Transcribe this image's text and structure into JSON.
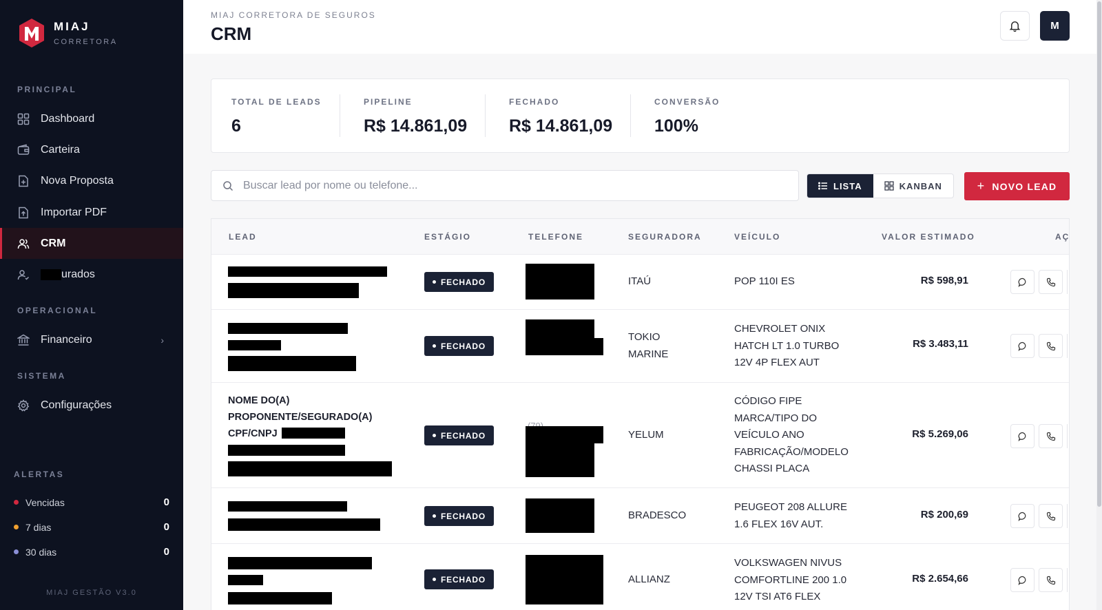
{
  "brand": {
    "name": "MIAJ",
    "sub": "CORRETORA"
  },
  "sidebar": {
    "sections": {
      "principal": "PRINCIPAL",
      "operacional": "OPERACIONAL",
      "sistema": "SISTEMA",
      "alertas": "ALERTAS"
    },
    "items": [
      {
        "label": "Dashboard",
        "icon": "grid-icon"
      },
      {
        "label": "Carteira",
        "icon": "wallet-icon"
      },
      {
        "label": "Nova Proposta",
        "icon": "file-plus-icon"
      },
      {
        "label": "Importar PDF",
        "icon": "file-upload-icon"
      },
      {
        "label": "CRM",
        "icon": "users-icon",
        "active": true
      },
      {
        "label": "urados",
        "icon": "user-check-icon"
      },
      {
        "label": "Financeiro",
        "icon": "bank-icon"
      },
      {
        "label": "Configurações",
        "icon": "gear-icon"
      }
    ],
    "alerts": [
      {
        "label": "Vencidas",
        "count": "0",
        "color": "#d1283f"
      },
      {
        "label": "7 dias",
        "count": "0",
        "color": "#f0a030"
      },
      {
        "label": "30 dias",
        "count": "0",
        "color": "#8a8fd6"
      }
    ],
    "version": "MIAJ GESTÃO V3.0"
  },
  "header": {
    "crumb": "MIAJ CORRETORA DE SEGUROS",
    "title": "CRM",
    "avatar": "M"
  },
  "stats": [
    {
      "label": "TOTAL DE LEADS",
      "value": "6"
    },
    {
      "label": "PIPELINE",
      "value": "R$ 14.861,09"
    },
    {
      "label": "FECHADO",
      "value": "R$ 14.861,09"
    },
    {
      "label": "CONVERSÃO",
      "value": "100%"
    }
  ],
  "toolbar": {
    "search_placeholder": "Buscar lead por nome ou telefone...",
    "view_list": "LISTA",
    "view_kanban": "KANBAN",
    "new_lead": "NOVO LEAD"
  },
  "table": {
    "headers": {
      "lead": "LEAD",
      "stage": "ESTÁGIO",
      "phone": "TELEFONE",
      "insurer": "SEGURADORA",
      "vehicle": "VEÍCULO",
      "value": "VALOR ESTIMADO",
      "actions": "AÇ"
    },
    "rows": [
      {
        "stage": "FECHADO",
        "insurer": "ITAÚ",
        "vehicle": "POP 110I ES",
        "value": "R$ 598,91"
      },
      {
        "stage": "FECHADO",
        "insurer": "TOKIO\nMARINE",
        "vehicle": "CHEVROLET ONIX\nHATCH LT 1.0 TURBO\n12V 4P FLEX AUT",
        "value": "R$ 3.483,11"
      },
      {
        "stage": "FECHADO",
        "lead_lines": [
          "NOME DO(A)",
          "PROPONENTE/SEGURADO(A)",
          "CPF/CNPJ"
        ],
        "phone_partial": "(79)",
        "insurer": "YELUM",
        "vehicle": "CÓDIGO FIPE\nMARCA/TIPO DO\nVEÍCULO ANO\nFABRICAÇÃO/MODELO\nCHASSI PLACA",
        "value": "R$ 5.269,06"
      },
      {
        "stage": "FECHADO",
        "insurer": "BRADESCO",
        "vehicle": "PEUGEOT 208 ALLURE\n1.6 FLEX 16V AUT.",
        "value": "R$ 200,69"
      },
      {
        "stage": "FECHADO",
        "insurer": "ALLIANZ",
        "vehicle": "VOLKSWAGEN NIVUS\nCOMFORTLINE 200 1.0\n12V TSI AT6 FLEX",
        "value": "R$ 2.654,66"
      }
    ]
  },
  "colors": {
    "accent": "#d1283f",
    "sidebar_bg": "#0d1220",
    "dark": "#1b2235"
  }
}
